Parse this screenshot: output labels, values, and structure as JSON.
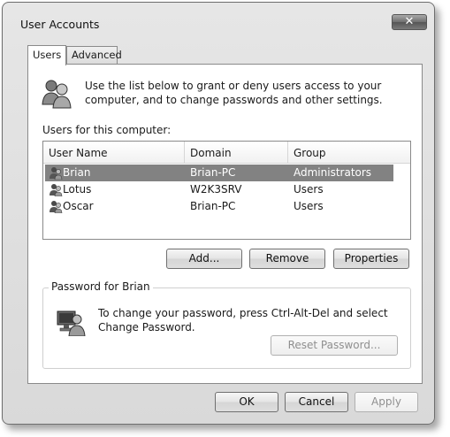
{
  "window": {
    "title": "User Accounts",
    "close_glyph": "✕"
  },
  "tabs": [
    {
      "label": "Users",
      "active": true
    },
    {
      "label": "Advanced",
      "active": false
    }
  ],
  "intro_text": "Use the list below to grant or deny users access to your computer, and to change passwords and other settings.",
  "users_label": "Users for this computer:",
  "list": {
    "columns": [
      "User Name",
      "Domain",
      "Group"
    ],
    "rows": [
      {
        "name": "Brian",
        "domain": "Brian-PC",
        "group": "Administrators",
        "selected": true,
        "icon": "user-icon"
      },
      {
        "name": "Lotus",
        "domain": "W2K3SRV",
        "group": "Users",
        "selected": false,
        "icon": "user-icon"
      },
      {
        "name": "Oscar",
        "domain": "Brian-PC",
        "group": "Users",
        "selected": false,
        "icon": "user-icon"
      }
    ]
  },
  "buttons": {
    "add": "Add...",
    "remove": "Remove",
    "properties": "Properties",
    "reset_password": "Reset Password...",
    "ok": "OK",
    "cancel": "Cancel",
    "apply": "Apply"
  },
  "password_group": {
    "title": "Password for Brian",
    "text": "To change your password, press Ctrl-Alt-Del and select Change Password."
  },
  "icons": {
    "panel": "users-icon",
    "password": "user-computer-icon"
  }
}
